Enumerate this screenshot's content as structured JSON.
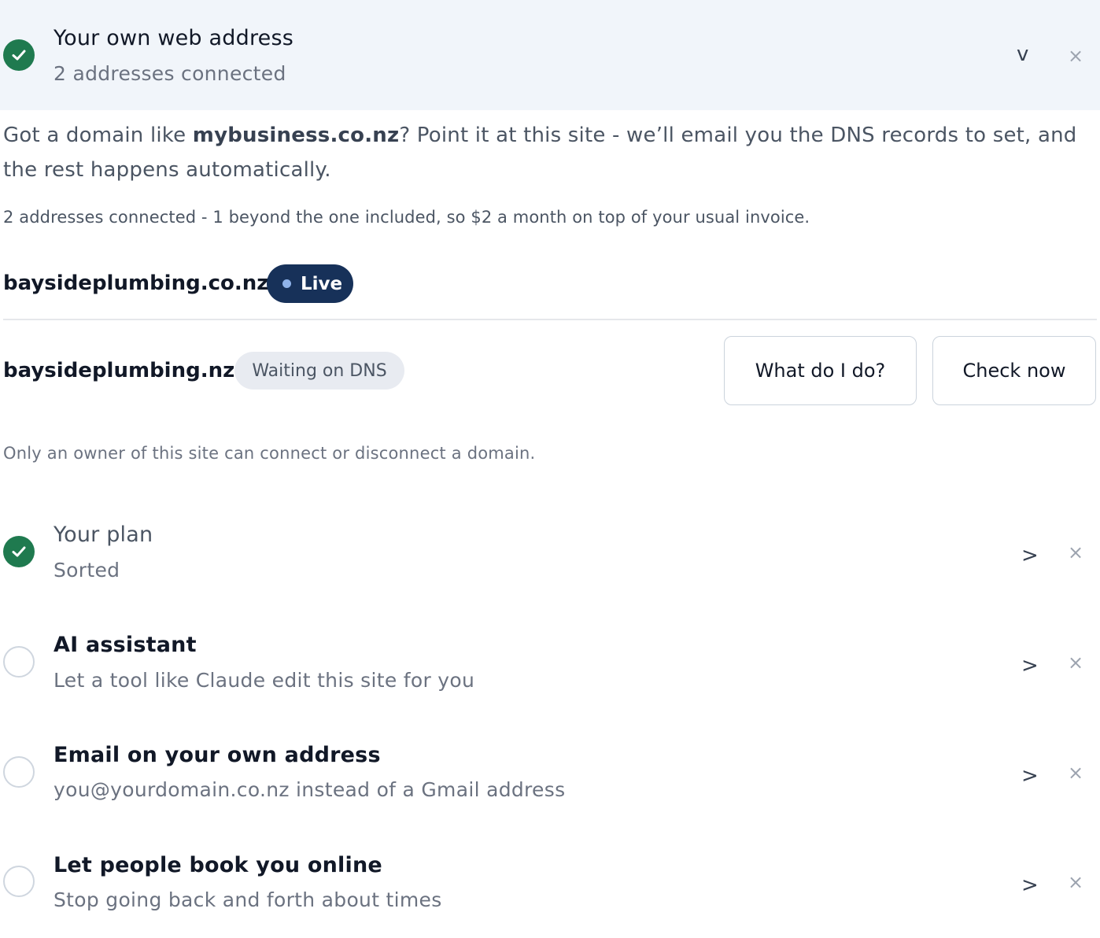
{
  "domain_section": {
    "title": "Your own web address",
    "subtitle": "2 addresses connected",
    "intro_prefix": "Got a domain like ",
    "intro_example": "mybusiness.co.nz",
    "intro_suffix": "? Point it at this site - we’ll email you the DNS records to set, and the rest happens automatically.",
    "billing_note": "2 addresses connected - 1 beyond the one included, so $2 a month on top of your usual invoice.",
    "domains": [
      {
        "name": "baysideplumbing.co.nz",
        "status": "Live"
      },
      {
        "name": "baysideplumbing.nz",
        "status": "Waiting on DNS",
        "help_button": "What do I do?",
        "check_button": "Check now"
      }
    ],
    "owner_note": "Only an owner of this site can connect or disconnect a domain."
  },
  "checklist": [
    {
      "title": "Your plan",
      "subtitle": "Sorted",
      "done": true
    },
    {
      "title": "AI assistant",
      "subtitle": "Let a tool like Claude edit this site for you",
      "done": false
    },
    {
      "title": "Email on your own address",
      "subtitle": "you@yourdomain.co.nz instead of a Gmail address",
      "done": false
    },
    {
      "title": "Let people book you online",
      "subtitle": "Stop going back and forth about times",
      "done": false
    }
  ],
  "icons": {
    "collapse": "v",
    "expand": ">",
    "dismiss": "×"
  },
  "colors": {
    "done_green": "#1f7a4f",
    "live_pill": "#173159",
    "header_bg": "#f1f5fa"
  }
}
